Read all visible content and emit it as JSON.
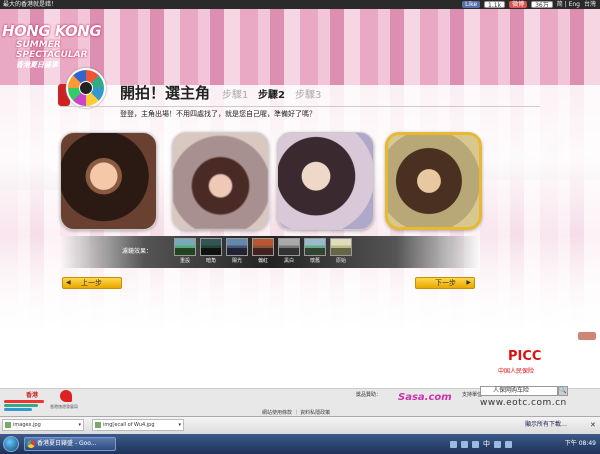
{
  "topbar": {
    "left_text": "最大的香港就是錯！",
    "like_label": "Like",
    "like_count": "1.1k",
    "weibo_label": "微博",
    "weibo_count": "36万",
    "lang_links": "简 | Eng",
    "region": "台灣"
  },
  "logo": {
    "line1": "HONG KONG",
    "line2": "SUMMER SPECTACULAR",
    "line3": "香港夏日盛事"
  },
  "steps": {
    "title": "開拍！選主角",
    "step1": "步驟1",
    "step2": "步驟2",
    "step3": "步驟3",
    "subtitle": "登登，主角出場！不用四處找了，就是您自己喔，準備好了嗎？"
  },
  "filters": {
    "label": "濾鏡效果：",
    "items": [
      "重設",
      "暗角",
      "陽光",
      "偏紅",
      "黑白",
      "懷舊",
      "原始"
    ]
  },
  "nav": {
    "prev_label": "上一步",
    "prev_arrow": "◀",
    "next_label": "下一步",
    "next_arrow": "▶"
  },
  "sponsor": {
    "picc_logo": "PICC",
    "picc_sub": "中国人民保险",
    "sponsor_label": "獎品贊助：",
    "sasa": "Sasa.com",
    "support_label": "支持單位：",
    "search_value": "人保网购车险",
    "search_go": "🔍",
    "watermark": "www.eotc.com.cn",
    "links": "網站使用條款 ｜ 資料私隱政策",
    "footer_logo_text": "香港",
    "footer_board": "香港旅遊發展局"
  },
  "downloads": {
    "item1": "imagex.jpg",
    "item2": "img[ecall of Wu4.jpg",
    "all_label": "顯示所有下載…",
    "close": "✕",
    "dropdown": "▾"
  },
  "taskbar": {
    "window_title": "香港夏日錶盛 - Goo...",
    "lang": "中",
    "clock": "下午 08:49"
  }
}
